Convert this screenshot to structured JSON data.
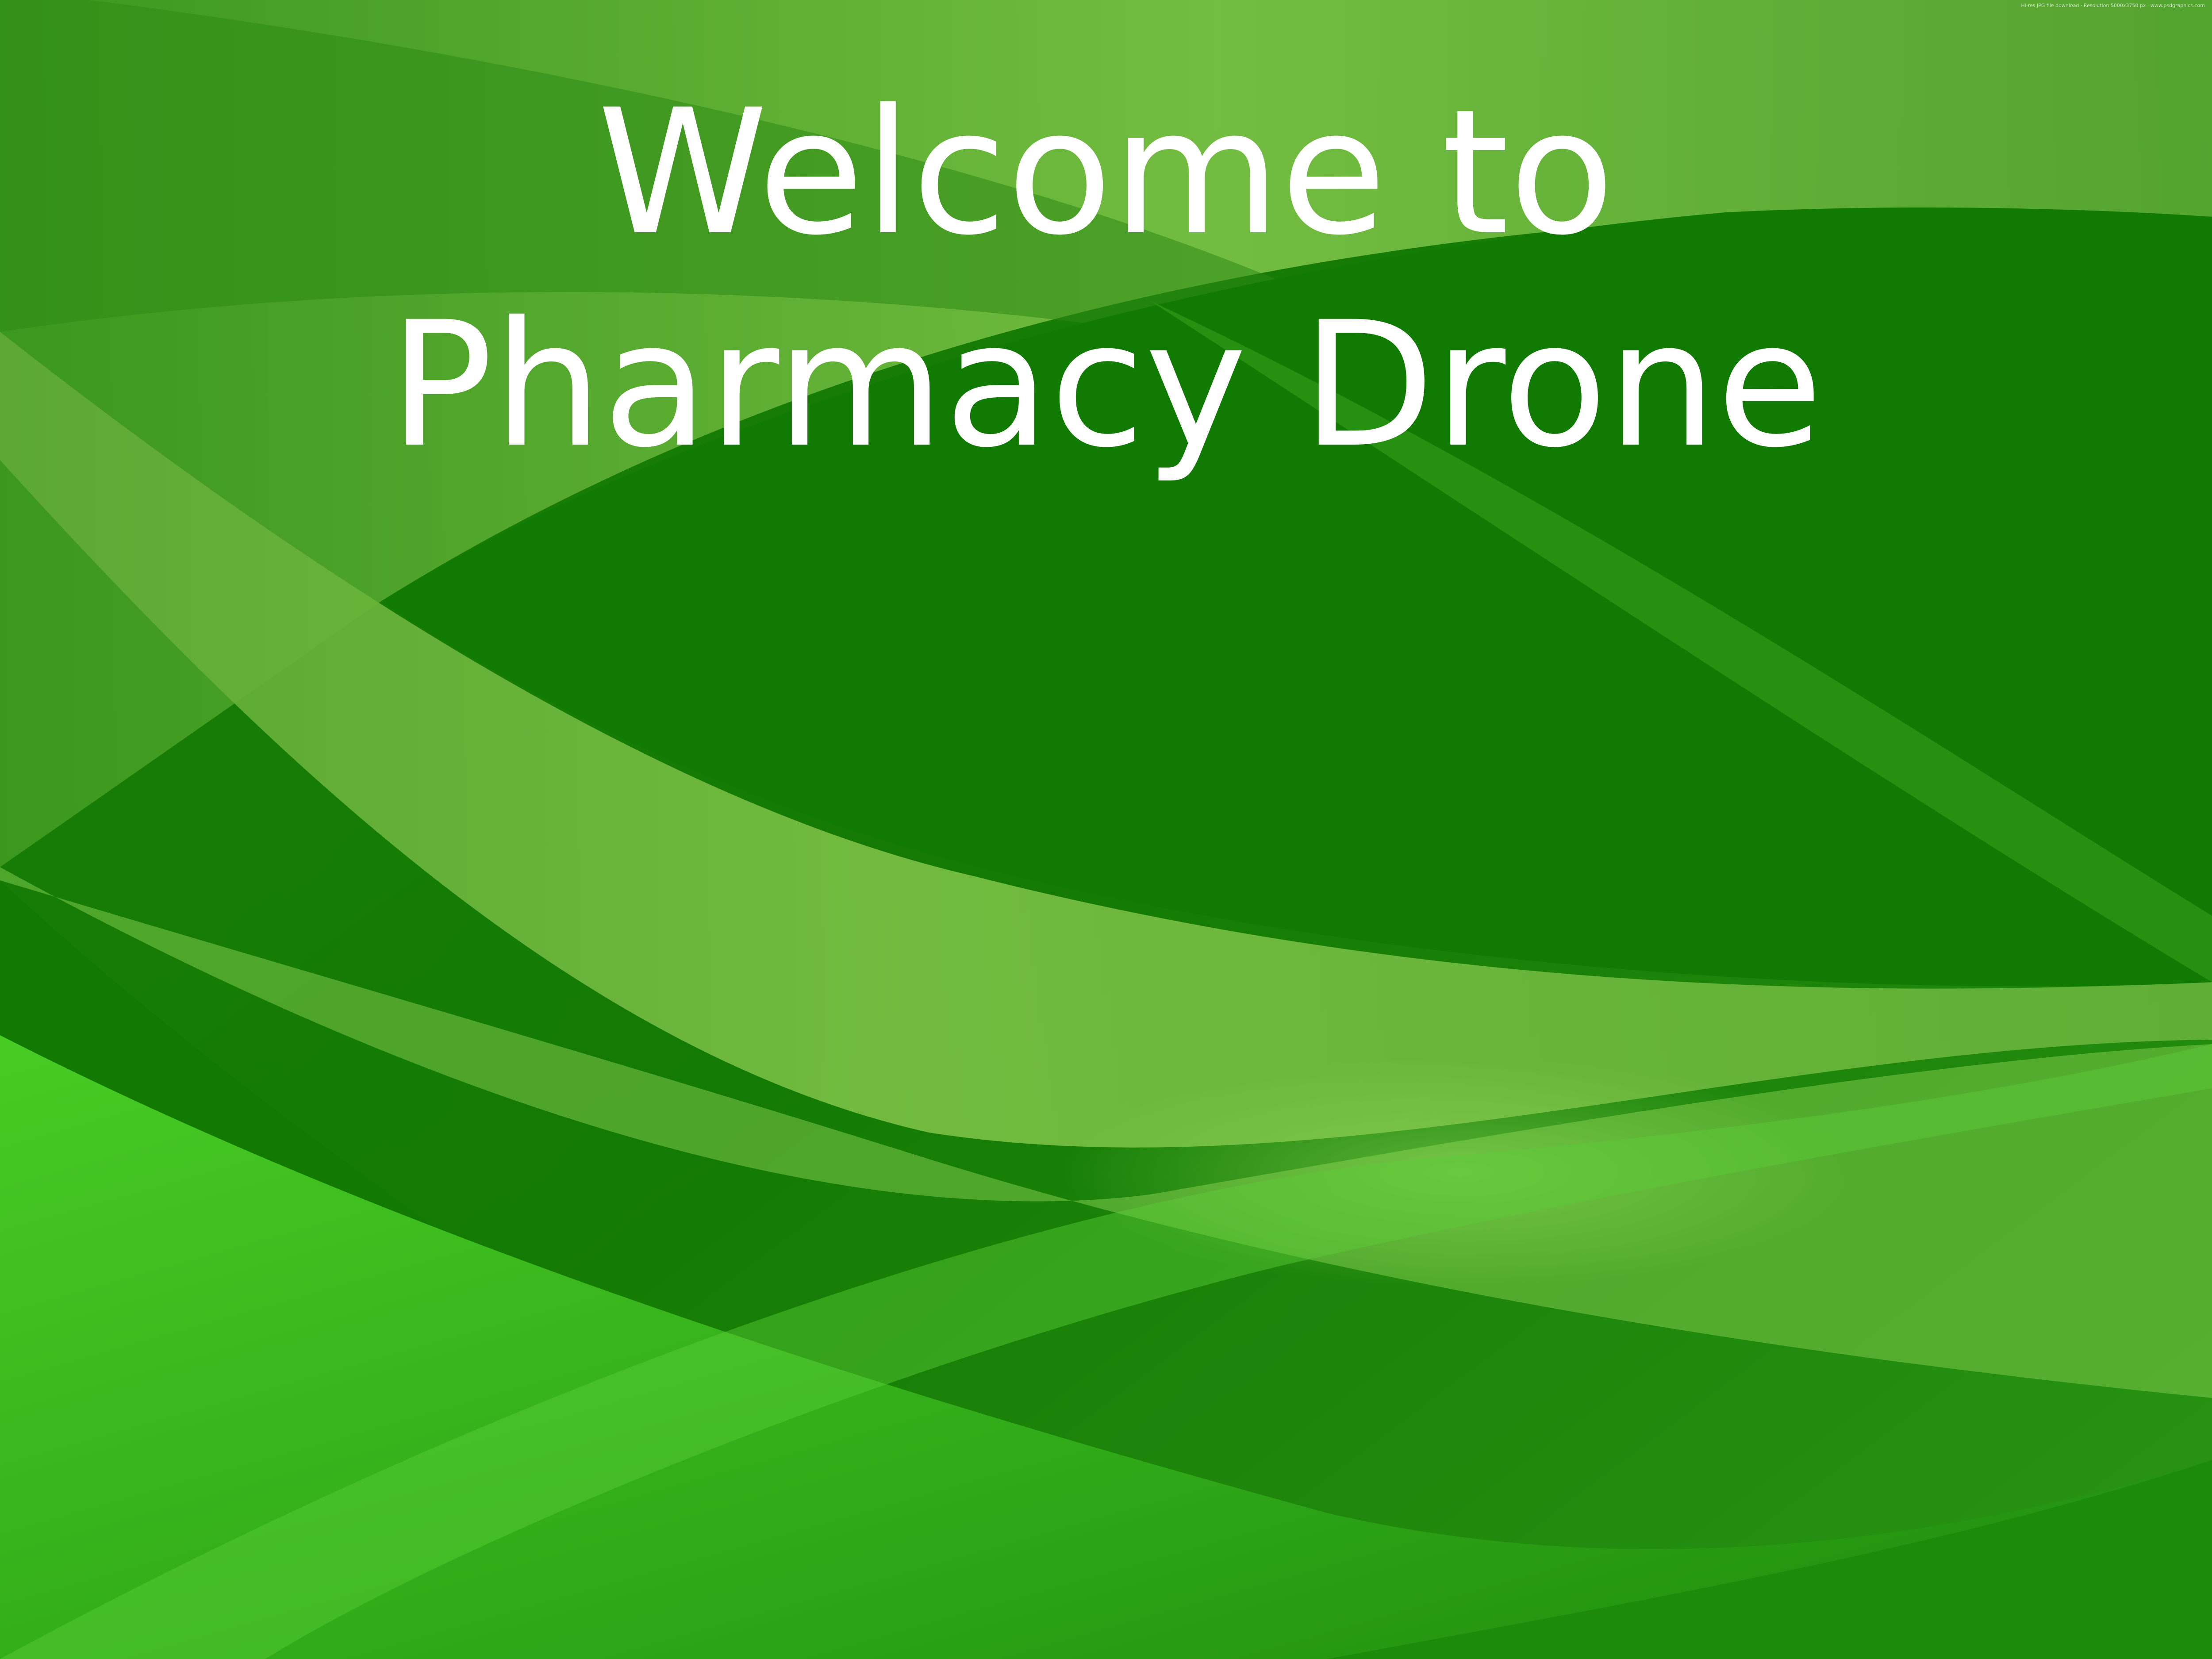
{
  "slide": {
    "title_line_1": "Welcome to",
    "title_line_2": "Pharmacy Drone",
    "text_color": "#ffffff"
  },
  "watermark": {
    "text": "Hi-res JPG file download · Resolution 5000x3750 px · www.psdgraphics.com"
  },
  "background": {
    "style": "green abstract waves",
    "colors": {
      "dark_green": "#127a03",
      "mid_green": "#2e9818",
      "light_green": "#7cc246",
      "bright_green": "#45c723"
    }
  }
}
